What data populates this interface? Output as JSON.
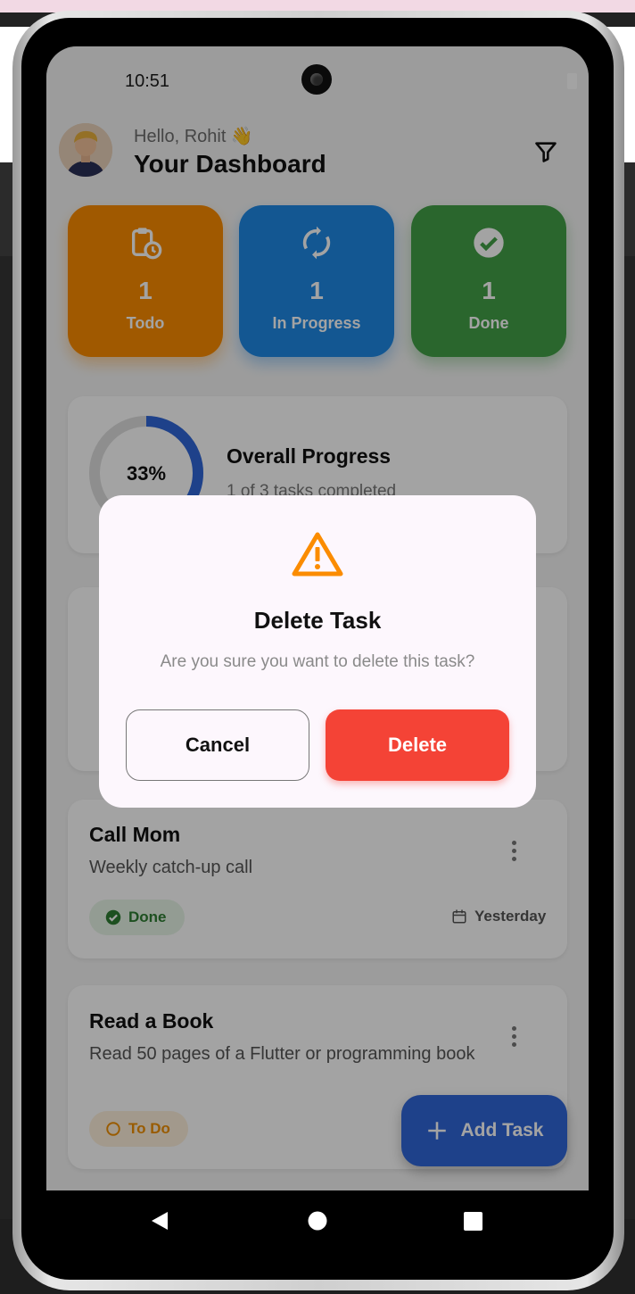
{
  "status_bar": {
    "time": "10:51"
  },
  "header": {
    "greeting": "Hello, Rohit 👋",
    "title": "Your Dashboard"
  },
  "stats": [
    {
      "count": "1",
      "label": "Todo",
      "icon": "clipboard-clock-icon",
      "color": "#fb8c00"
    },
    {
      "count": "1",
      "label": "In Progress",
      "icon": "sync-icon",
      "color": "#1e88e5"
    },
    {
      "count": "1",
      "label": "Done",
      "icon": "check-circle-icon",
      "color": "#43a047"
    }
  ],
  "progress": {
    "percent_text": "33%",
    "fraction": 0.3333,
    "title": "Overall Progress",
    "subtitle": "1 of 3 tasks completed"
  },
  "tasks": [
    {
      "title": "Call Mom",
      "description": "Weekly catch-up call",
      "status": "Done",
      "due": "Yesterday"
    },
    {
      "title": "Read a Book",
      "description": "Read 50 pages of a Flutter or programming book",
      "status": "To Do"
    }
  ],
  "fab": {
    "label": "Add Task"
  },
  "dialog": {
    "title": "Delete Task",
    "message": "Are you sure you want to delete this task?",
    "cancel_label": "Cancel",
    "delete_label": "Delete",
    "icon": "warning-icon"
  },
  "colors": {
    "accent": "#2f66d8",
    "danger": "#f44336",
    "warning": "#fb8c00"
  }
}
